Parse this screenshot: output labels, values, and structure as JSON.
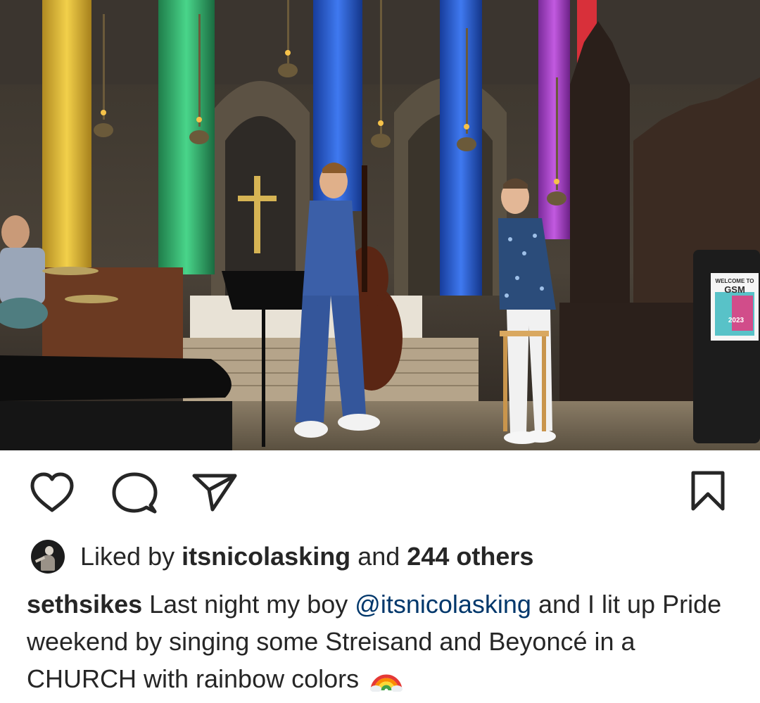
{
  "post": {
    "image": {
      "subject": "photo",
      "sign": {
        "line1": "WELCOME TO",
        "line2": "GSM",
        "year": "2023"
      }
    },
    "actions": {
      "like_icon": "heart-outline-icon",
      "comment_icon": "speech-bubble-icon",
      "share_icon": "paper-plane-icon",
      "save_icon": "bookmark-outline-icon"
    },
    "likes": {
      "prefix": "Liked by",
      "user": "itsnicolasking",
      "middle": "and",
      "count_text": "244 others"
    },
    "caption": {
      "author": "sethsikes",
      "text_before": "Last night my boy",
      "mention": "@itsnicolasking",
      "text_after": "and I lit up Pride weekend by singing some Streisand and Beyoncé in a CHURCH with rainbow colors",
      "emoji": "rainbow-emoji"
    },
    "colors": {
      "text": "#262626",
      "mention": "#00376b",
      "background": "#ffffff"
    }
  }
}
